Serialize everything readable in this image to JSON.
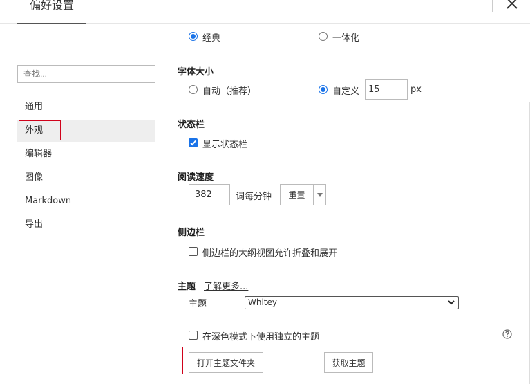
{
  "window": {
    "title": "偏好设置",
    "close_icon": "close-icon"
  },
  "sidebar": {
    "search_placeholder": "查找...",
    "items": [
      {
        "label": "通用"
      },
      {
        "label": "外观"
      },
      {
        "label": "编辑器"
      },
      {
        "label": "图像"
      },
      {
        "label": "Markdown"
      },
      {
        "label": "导出"
      }
    ],
    "active": "外观",
    "highlight_color": "#d0021b"
  },
  "appearance": {
    "window_style": {
      "options": [
        "经典",
        "一体化"
      ],
      "selected": "经典"
    },
    "font_size": {
      "title": "字体大小",
      "options": [
        "自动（推荐）",
        "自定义"
      ],
      "selected": "自定义",
      "custom_value": "15",
      "unit": "px"
    },
    "status_bar": {
      "title": "状态栏",
      "checkbox_label": "显示状态栏",
      "checked": true
    },
    "reading_speed": {
      "title": "阅读速度",
      "value": "382",
      "unit_label": "词每分钟",
      "reset_label": "重置",
      "dropdown_icon": "caret-down-icon"
    },
    "sidebar_section": {
      "title": "侧边栏",
      "checkbox_label": "侧边栏的大纲视图允许折叠和展开",
      "checked": false
    },
    "theme": {
      "title": "主题",
      "learn_more": "了解更多...",
      "field_label": "主题",
      "selected": "Whitey",
      "dark_mode_label": "在深色模式下使用独立的主题",
      "dark_mode_checked": false,
      "open_folder_label": "打开主题文件夹",
      "get_theme_label": "获取主题",
      "help_icon": "help-icon"
    },
    "accent_color": "#1a73e8"
  }
}
